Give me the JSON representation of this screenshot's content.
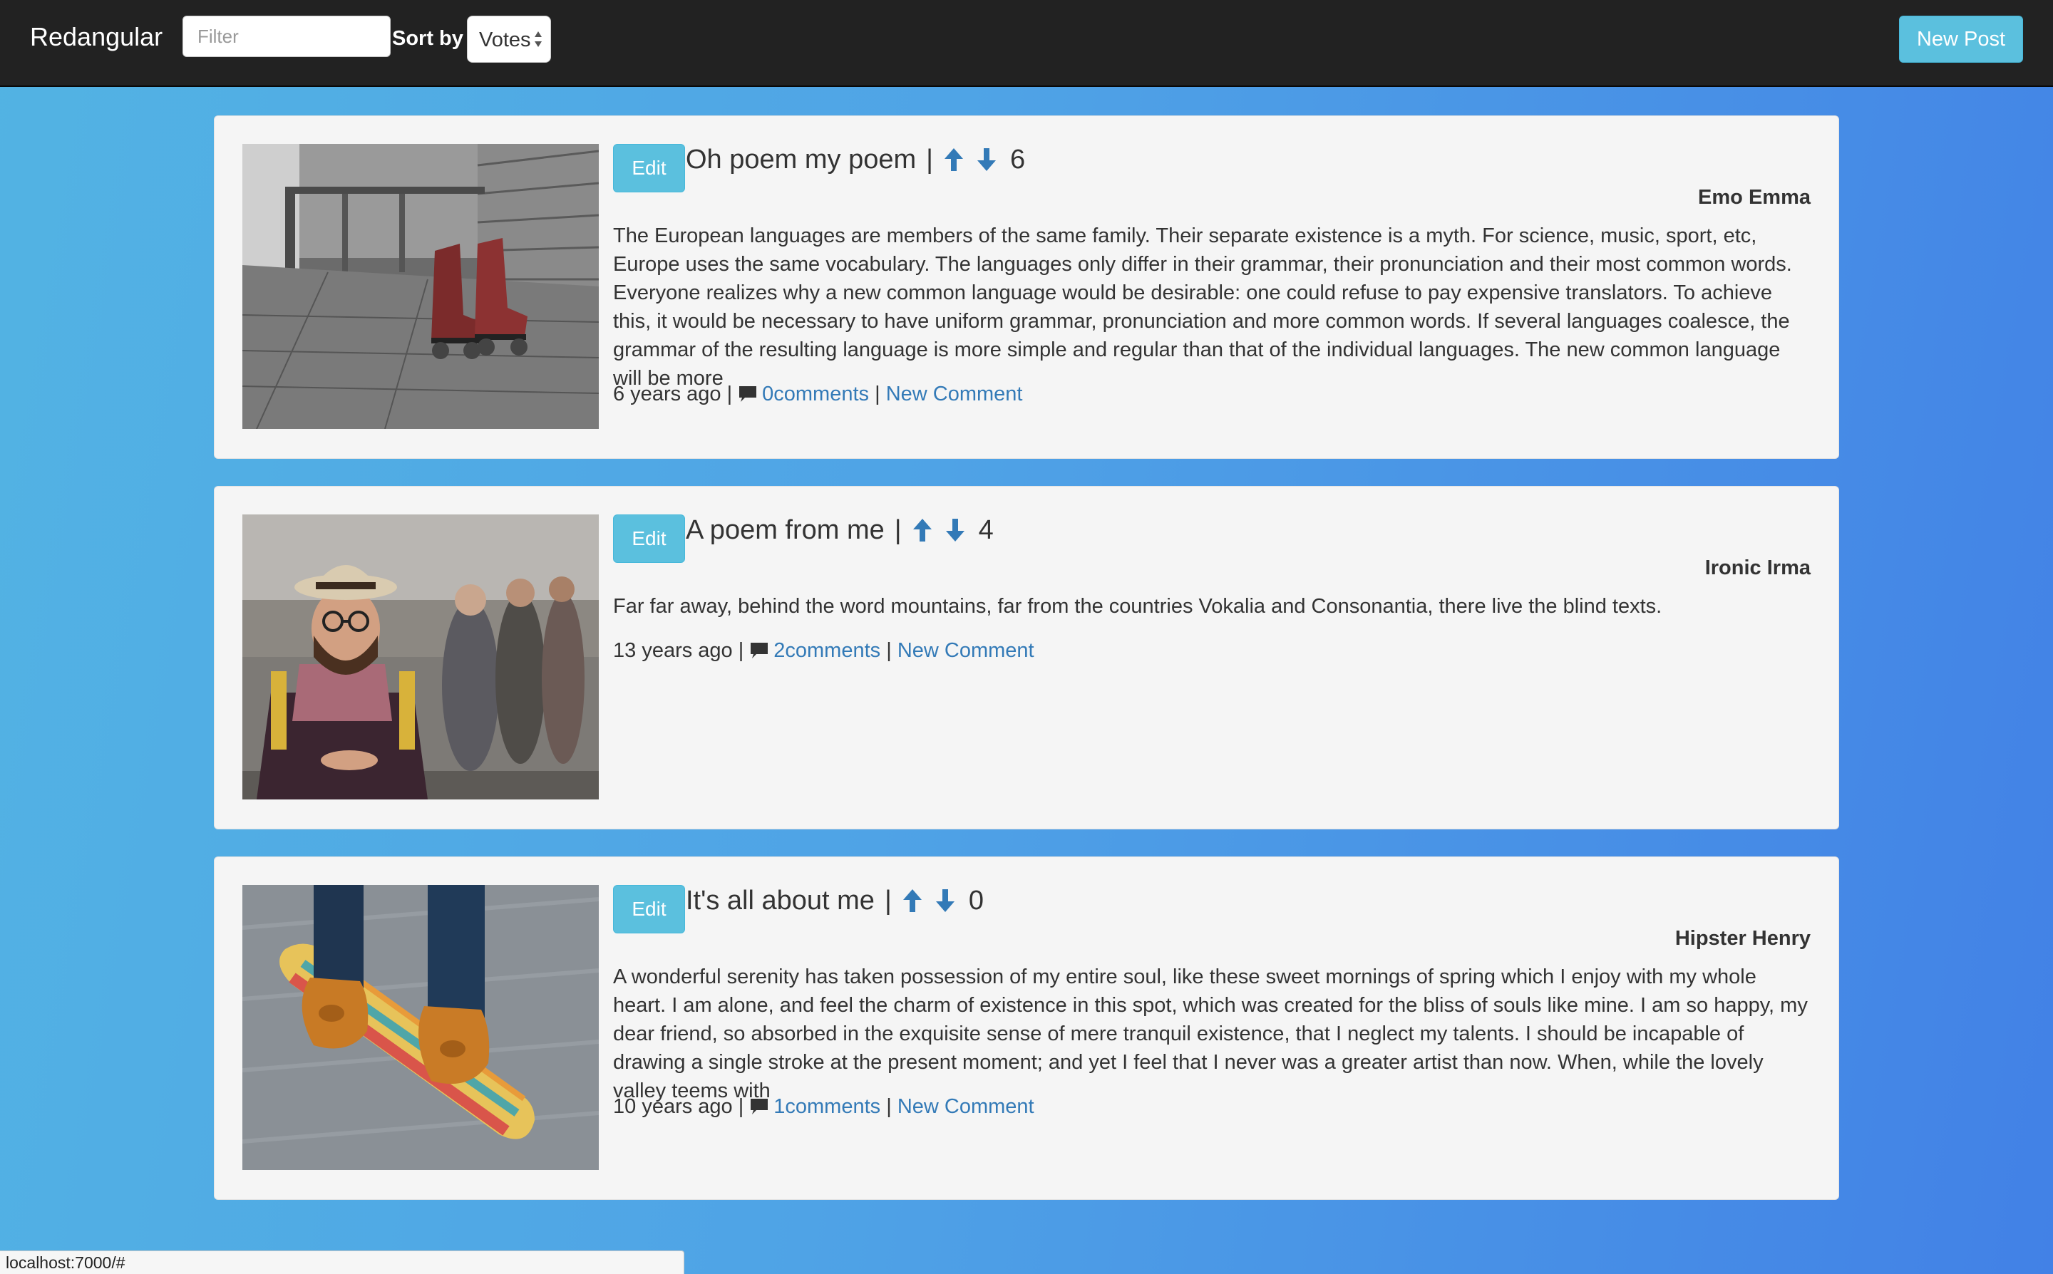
{
  "navbar": {
    "brand": "Redangular",
    "filter_placeholder": "Filter",
    "filter_value": "",
    "sort_label": "Sort by",
    "sort_value": "Votes",
    "new_post_label": "New Post"
  },
  "posts": [
    {
      "edit_label": "Edit",
      "title": "Oh poem my poem",
      "votes": "6",
      "author": "Emo Emma",
      "body": "The European languages are members of the same family. Their separate existence is a myth. For science, music, sport, etc, Europe uses the same vocabulary. The languages only differ in their grammar, their pronunciation and their most common words. Everyone realizes why a new common language would be desirable: one could refuse to pay expensive translators. To achieve this, it would be necessary to have uniform grammar, pronunciation and more common words. If several languages coalesce, the grammar of the resulting language is more simple and regular than that of the individual languages. The new common language will be more",
      "time": "6 years ago",
      "comments": "0comments",
      "new_comment": "New Comment"
    },
    {
      "edit_label": "Edit",
      "title": "A poem from me",
      "votes": "4",
      "author": "Ironic Irma",
      "body": "Far far away, behind the word mountains, far from the countries Vokalia and Consonantia, there live the blind texts.",
      "time": "13 years ago",
      "comments": "2comments",
      "new_comment": "New Comment"
    },
    {
      "edit_label": "Edit",
      "title": "It's all about me",
      "votes": "0",
      "author": "Hipster Henry",
      "body": "A wonderful serenity has taken possession of my entire soul, like these sweet mornings of spring which I enjoy with my whole heart. I am alone, and feel the charm of existence in this spot, which was created for the bliss of souls like mine. I am so happy, my dear friend, so absorbed in the exquisite sense of mere tranquil existence, that I neglect my talents. I should be incapable of drawing a single stroke at the present moment; and yet I feel that I never was a greater artist than now. When, while the lovely valley teems with",
      "time": "10 years ago",
      "comments": "1comments",
      "new_comment": "New Comment"
    }
  ],
  "status_bar": {
    "url": "localhost:7000/#"
  },
  "icons": {
    "upvote": "arrow-up-icon",
    "downvote": "arrow-down-icon",
    "comment": "comment-icon"
  },
  "colors": {
    "navbar": "#222222",
    "button_info": "#5bc0de",
    "link": "#337ab7",
    "vote_arrow": "#337ab7",
    "card": "#f5f5f5"
  }
}
